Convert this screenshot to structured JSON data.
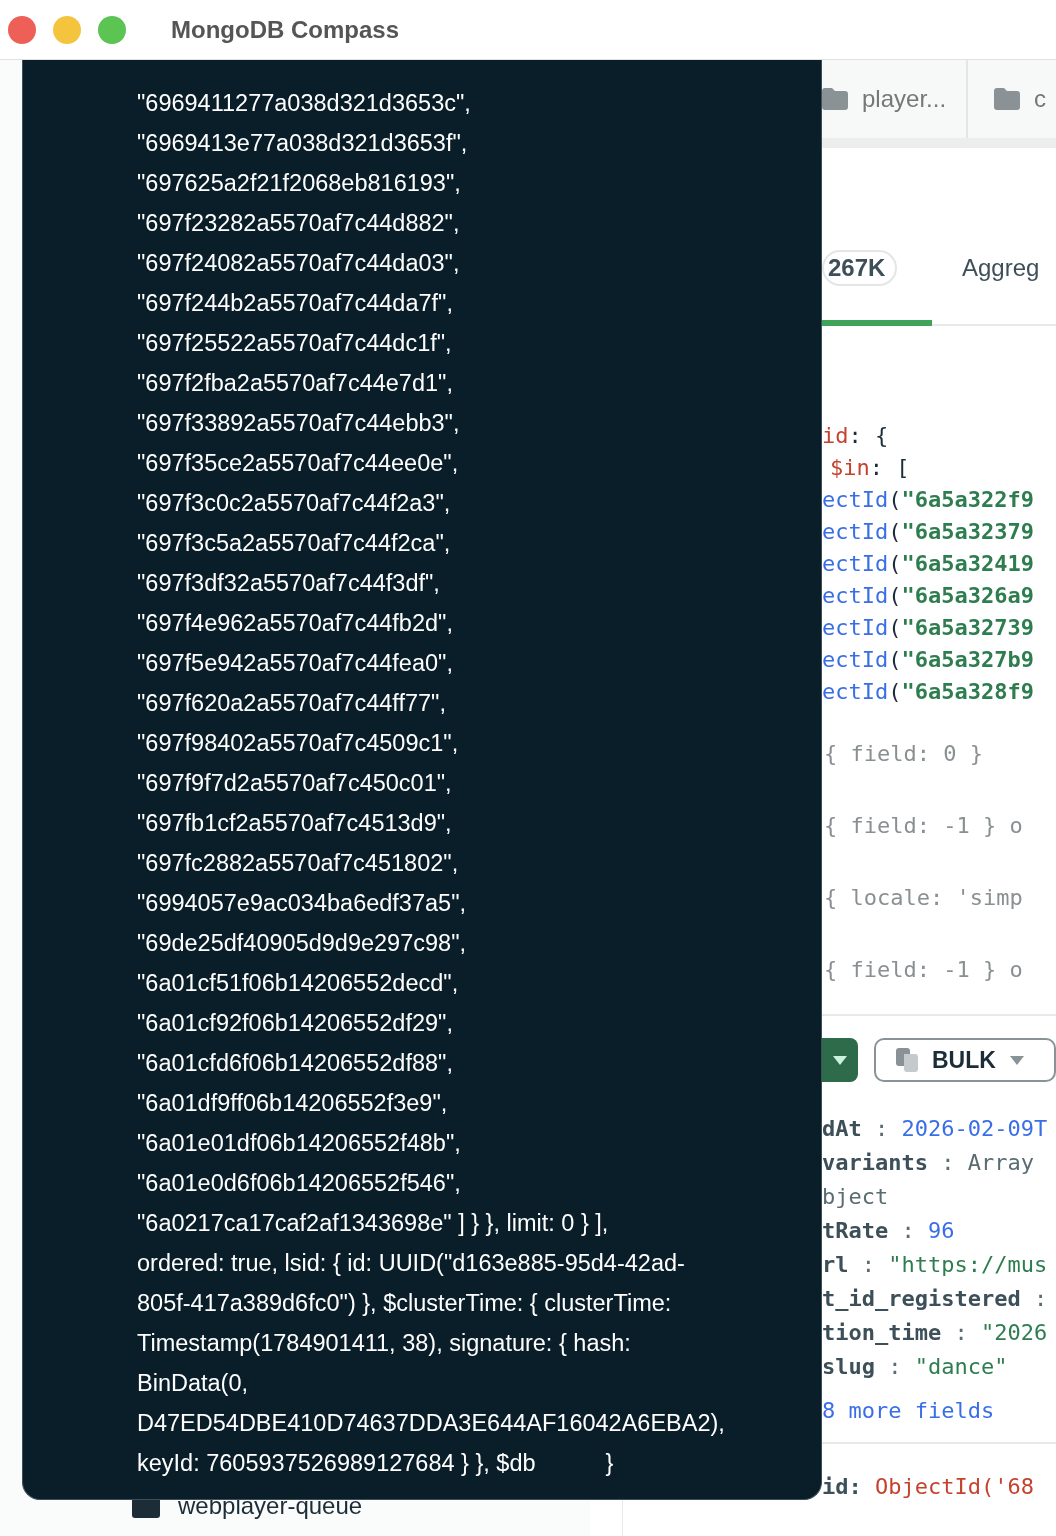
{
  "window": {
    "title": "MongoDB Compass"
  },
  "tabs": [
    {
      "label": "player...",
      "selected": false
    },
    {
      "label": "c",
      "selected": false
    }
  ],
  "view_tabs": [
    {
      "label": "267K",
      "kind": "count",
      "selected": true
    },
    {
      "label": "Aggreg",
      "kind": "tab",
      "selected": false
    }
  ],
  "query": {
    "key": "id",
    "open": ": {",
    "inner": {
      "key": "$in",
      "open": ": [",
      "items": [
        {
          "func": "ectId",
          "open": "(",
          "value": "\"6a5a322f9"
        },
        {
          "func": "ectId",
          "open": "(",
          "value": "\"6a5a32379"
        },
        {
          "func": "ectId",
          "open": "(",
          "value": "\"6a5a32419"
        },
        {
          "func": "ectId",
          "open": "(",
          "value": "\"6a5a326a9"
        },
        {
          "func": "ectId",
          "open": "(",
          "value": "\"6a5a32739"
        },
        {
          "func": "ectId",
          "open": "(",
          "value": "\"6a5a327b9"
        },
        {
          "func": "ectId",
          "open": "(",
          "value": "\"6a5a328f9"
        }
      ]
    }
  },
  "options": [
    "{ field: 0 }",
    "{ field: -1 } o",
    "{ locale: 'simp",
    "{ field: -1 } o"
  ],
  "toolbar": {
    "bulk_label": "BULK"
  },
  "document": {
    "fields": [
      {
        "key": "dAt",
        "sep": ":",
        "value": "2026-02-09T",
        "kind": "date"
      },
      {
        "key": "variants",
        "sep": ":",
        "value": "Array",
        "kind": "type"
      },
      {
        "value": "bject",
        "kind": "type"
      },
      {
        "key": "tRate",
        "sep": ":",
        "value": "96",
        "kind": "number"
      },
      {
        "key": "rl",
        "sep": ":",
        "value": "\"https://mus",
        "kind": "string"
      },
      {
        "key": "t_id_registered",
        "sep": ":"
      },
      {
        "key": "tion_time",
        "sep": ":",
        "value": "\"2026",
        "kind": "string"
      },
      {
        "key": "slug",
        "sep": ":",
        "value": "\"dance\"",
        "kind": "string"
      }
    ],
    "more": "8 more fields"
  },
  "next_document": {
    "key": "id:",
    "value": "ObjectId('68"
  },
  "sidebar": {
    "items": [
      {
        "label": "webplayer-queue"
      }
    ]
  },
  "tooltip": {
    "lines": [
      "\"6969411277a038d321d3653c\",",
      "\"6969413e77a038d321d3653f\",",
      "\"697625a2f21f2068eb816193\",",
      "\"697f23282a5570af7c44d882\",",
      "\"697f24082a5570af7c44da03\",",
      "\"697f244b2a5570af7c44da7f\",",
      "\"697f25522a5570af7c44dc1f\",",
      "\"697f2fba2a5570af7c44e7d1\",",
      "\"697f33892a5570af7c44ebb3\",",
      "\"697f35ce2a5570af7c44ee0e\",",
      "\"697f3c0c2a5570af7c44f2a3\",",
      "\"697f3c5a2a5570af7c44f2ca\",",
      "\"697f3df32a5570af7c44f3df\",",
      "\"697f4e962a5570af7c44fb2d\",",
      "\"697f5e942a5570af7c44fea0\",",
      "\"697f620a2a5570af7c44ff77\",",
      "\"697f98402a5570af7c4509c1\",",
      "\"697f9f7d2a5570af7c450c01\",",
      "\"697fb1cf2a5570af7c4513d9\",",
      "\"697fc2882a5570af7c451802\",",
      "\"6994057e9ac034ba6edf37a5\",",
      "\"69de25df40905d9d9e297c98\",",
      "\"6a01cf51f06b14206552decd\",",
      "\"6a01cf92f06b14206552df29\",",
      "\"6a01cfd6f06b14206552df88\",",
      "\"6a01df9ff06b14206552f3e9\",",
      "\"6a01e01df06b14206552f48b\",",
      "\"6a01e0d6f06b14206552f546\",",
      "\"6a0217ca17caf2af1343698e\" ] } }, limit: 0 } ],",
      "ordered: true, lsid: { id: UUID(\"d163e885-95d4-42ad-",
      "805f-417a389d6fc0\") }, $clusterTime: { clusterTime:",
      "Timestamp(1784901411, 38), signature: { hash:",
      "BinData(0,",
      "D47ED54DBE410D74637DDA3E644AF16042A6EBA2),"
    ],
    "last_line": {
      "before": "keyId: 7605937526989127684 } }, $db",
      "after": "}"
    }
  }
}
